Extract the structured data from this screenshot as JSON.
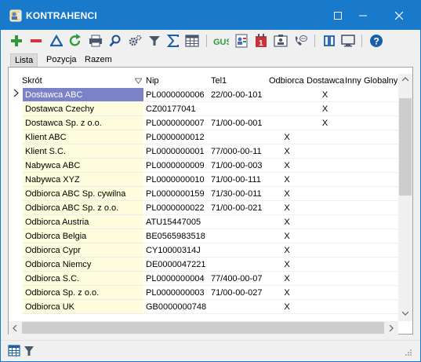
{
  "window": {
    "title": "KONTRAHENCI",
    "minimize_icon": "minimize-icon",
    "maximize_icon": "maximize-icon",
    "close_icon": "close-icon",
    "titlebar_color": "#1979ca"
  },
  "toolbar": {
    "buttons": [
      "add-icon",
      "remove-icon",
      "filter-delta-icon",
      "refresh-icon",
      "print-icon",
      "search-icon",
      "settings-icon",
      "filter-icon",
      "sum-icon",
      "columns-icon",
      "gus-icon",
      "contacts-icon",
      "calendar-icon",
      "card-icon",
      "phone-icon",
      "panels-icon",
      "display-icon",
      "help-icon"
    ],
    "gus_label": "GUS"
  },
  "tabs": [
    {
      "label": "Lista",
      "active": true
    },
    {
      "label": "Pozycja",
      "active": false
    },
    {
      "label": "Razem",
      "active": false
    }
  ],
  "grid": {
    "columns": {
      "name": "Skrót",
      "nip": "Nip",
      "tel": "Tel1",
      "odbiorca": "Odbiorca",
      "dostawca": "Dostawca",
      "inny": "Inny",
      "globalny": "Globalny"
    },
    "rows": [
      {
        "name": "Dostawca ABC",
        "nip": "PL0000000006",
        "tel": "22/00-00-101",
        "odbiorca": "",
        "dostawca": "X",
        "selected": true
      },
      {
        "name": "Dostawca Czechy",
        "nip": "CZ00177041",
        "tel": "",
        "odbiorca": "",
        "dostawca": "X"
      },
      {
        "name": "Dostawca Sp. z o.o.",
        "nip": "PL0000000007",
        "tel": "71/00-00-001",
        "odbiorca": "",
        "dostawca": "X"
      },
      {
        "name": "Klient ABC",
        "nip": "PL0000000012",
        "tel": "",
        "odbiorca": "X",
        "dostawca": ""
      },
      {
        "name": "Klient S.C.",
        "nip": "PL0000000001",
        "tel": "77/000-00-11",
        "odbiorca": "X",
        "dostawca": ""
      },
      {
        "name": "Nabywca ABC",
        "nip": "PL0000000009",
        "tel": "71/00-00-003",
        "odbiorca": "X",
        "dostawca": ""
      },
      {
        "name": "Nabywca XYZ",
        "nip": "PL0000000010",
        "tel": "71/00-00-111",
        "odbiorca": "X",
        "dostawca": ""
      },
      {
        "name": "Odbiorca ABC Sp. cywilna",
        "nip": "PL0000000159",
        "tel": "71/30-00-011",
        "odbiorca": "X",
        "dostawca": ""
      },
      {
        "name": "Odbiorca ABC Sp. z o.o.",
        "nip": "PL0000000022",
        "tel": "71/00-00-021",
        "odbiorca": "X",
        "dostawca": ""
      },
      {
        "name": "Odbiorca Austria",
        "nip": "ATU15447005",
        "tel": "",
        "odbiorca": "X",
        "dostawca": ""
      },
      {
        "name": "Odbiorca Belgia",
        "nip": "BE0565983518",
        "tel": "",
        "odbiorca": "X",
        "dostawca": ""
      },
      {
        "name": "Odbiorca Cypr",
        "nip": "CY10000314J",
        "tel": "",
        "odbiorca": "X",
        "dostawca": ""
      },
      {
        "name": "Odbiorca Niemcy",
        "nip": "DE0000047221",
        "tel": "",
        "odbiorca": "X",
        "dostawca": ""
      },
      {
        "name": "Odbiorca S.C.",
        "nip": "PL0000000004",
        "tel": "77/400-00-07",
        "odbiorca": "X",
        "dostawca": ""
      },
      {
        "name": "Odbiorca Sp. z o.o.",
        "nip": "PL0000000003",
        "tel": "71/00-00-027",
        "odbiorca": "X",
        "dostawca": ""
      },
      {
        "name": "Odbiorca UK",
        "nip": "GB0000000748",
        "tel": "",
        "odbiorca": "X",
        "dostawca": ""
      }
    ]
  },
  "statusbar": {
    "icons": [
      "grid-view-icon",
      "filter-icon",
      "resize-grip-icon"
    ]
  }
}
